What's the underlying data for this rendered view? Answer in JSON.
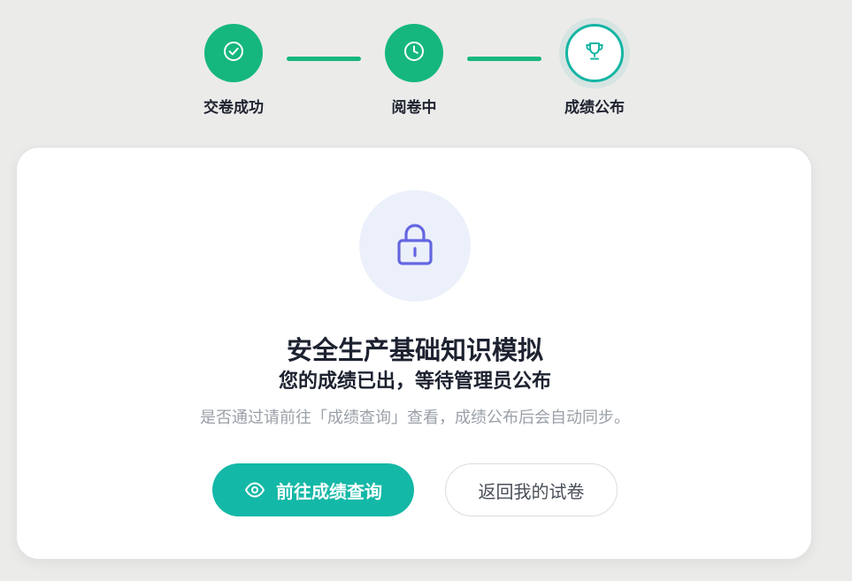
{
  "steps": [
    {
      "label": "交卷成功",
      "icon": "check-circle-icon",
      "state": "done"
    },
    {
      "label": "阅卷中",
      "icon": "clock-icon",
      "state": "done"
    },
    {
      "label": "成绩公布",
      "icon": "trophy-icon",
      "state": "active"
    }
  ],
  "card": {
    "icon": "lock-icon",
    "title": "安全生产基础知识模拟",
    "subtitle": "您的成绩已出，等待管理员公布",
    "hint": "是否通过请前往「成绩查询」查看，成绩公布后会自动同步。",
    "primary_button": {
      "label": "前往成绩查询",
      "icon": "eye-icon"
    },
    "secondary_button": {
      "label": "返回我的试卷"
    }
  },
  "colors": {
    "done": "#15b77e",
    "active_ring": "#15b5a4",
    "primary_button": "#14b8a6",
    "lock_icon": "#6366e0",
    "lock_bubble": "#ecf0fb",
    "background": "#ebebea"
  }
}
